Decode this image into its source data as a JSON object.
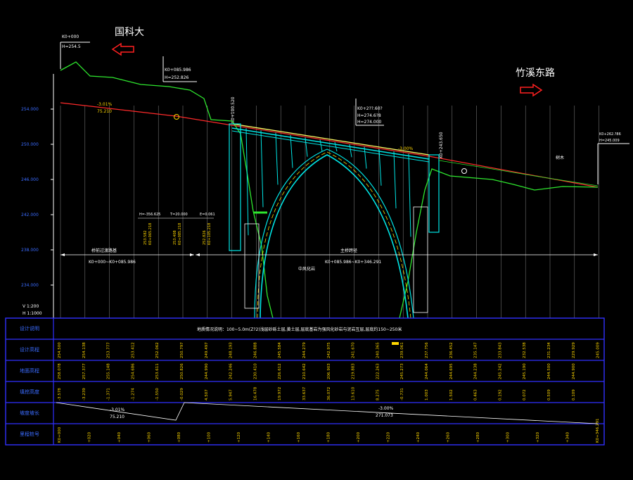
{
  "labels": {
    "left_direction": "国科大",
    "right_direction": "竹溪东路",
    "left_station_1": "K0+000",
    "left_station_2": "H=254.5",
    "mid_station_1": "K0+085.986",
    "mid_station_2": "H=252.826",
    "left_bridge_station": "K0+100.520",
    "right_bridge_station": "K0+243.650",
    "vcurve_station": "K0+2??.60?",
    "vcurve_elev_1": "H=274.6?8",
    "vcurve_elev_2": "H=274.000",
    "right_end_1": "K0+262.?86",
    "right_end_2": "H=245.009",
    "grade_left": "-3.01%",
    "grade_left_len": "75.210",
    "grade_right": "-3.00%",
    "grade_right_len": "271.073",
    "left_span_1": "桥前过渡路基",
    "left_span_2": "K0+000~K0+085.986",
    "main_span_1": "主桥跨径",
    "main_span_2": "K0+085.986~K0+346.291",
    "curve_h": "H=-356.625",
    "curve_t": "T=20.000",
    "curve_e": "E=0.061",
    "vert_a_1": "253.582",
    "vert_a_2": "K0+065.218",
    "vert_b_1": "253.408",
    "vert_b_2": "K0+085.218",
    "vert_c_1": "252.826",
    "vert_c_2": "K0+105.218",
    "note_rock": "中风化岩",
    "note_tree": "树木",
    "scale_v": "V 1:200",
    "scale_h": "H 1:1000",
    "table_note": "地质情况说明：100~5.0m(Z?2)浅层砂砾土层,黄土层,层底基岩为强风化砂岩与泥岩互层,层底约150~250米",
    "y_ticks": [
      "254.000",
      "250.000",
      "246.000",
      "242.000",
      "238.000",
      "234.000"
    ],
    "rows": [
      {
        "name": "设计说明"
      },
      {
        "name": "设计高程"
      },
      {
        "name": "地面高程"
      },
      {
        "name": "填挖高度"
      },
      {
        "name": "坡度坡长"
      },
      {
        "name": "里程桩号"
      }
    ],
    "row_design": [
      "254.500",
      "254.138",
      "253.777",
      "253.412",
      "252.062",
      "250.797",
      "249.497",
      "248.193",
      "246.888",
      "245.584",
      "244.279",
      "242.975",
      "241.670",
      "240.365",
      "239.061",
      "237.756",
      "236.452",
      "235.147",
      "233.843",
      "232.538",
      "231.234",
      "229.929",
      "245.009"
    ],
    "row_ground": [
      "258.078",
      "257.377",
      "255.148",
      "254.686",
      "253.611",
      "250.826",
      "244.990",
      "242.246",
      "230.410",
      "226.612",
      "210.642",
      "206.903",
      "219.883",
      "222.263",
      "245.273",
      "244.064",
      "244.695",
      "244.238",
      "245.242",
      "245.190",
      "244.500",
      "244.900"
    ],
    "row_fill": [
      "-3.578",
      "-3.239",
      "-1.371",
      "-1.274",
      "-1.550",
      "-0.029",
      "4.507",
      "5.947",
      "16.478",
      "19.972",
      "33.637",
      "36.072",
      "13.610",
      "8.275",
      "-0.731",
      "1.003",
      "1.502",
      "0.463",
      "0.192",
      "0.072",
      "0.509",
      "0.109"
    ],
    "row_station": [
      "K0+000",
      "+020",
      "+040",
      "+060",
      "+080",
      "+100",
      "+120",
      "+140",
      "+160",
      "+180",
      "+200",
      "+220",
      "+240",
      "+260",
      "+280",
      "+300",
      "+320",
      "+340",
      "K0+346.291"
    ]
  }
}
